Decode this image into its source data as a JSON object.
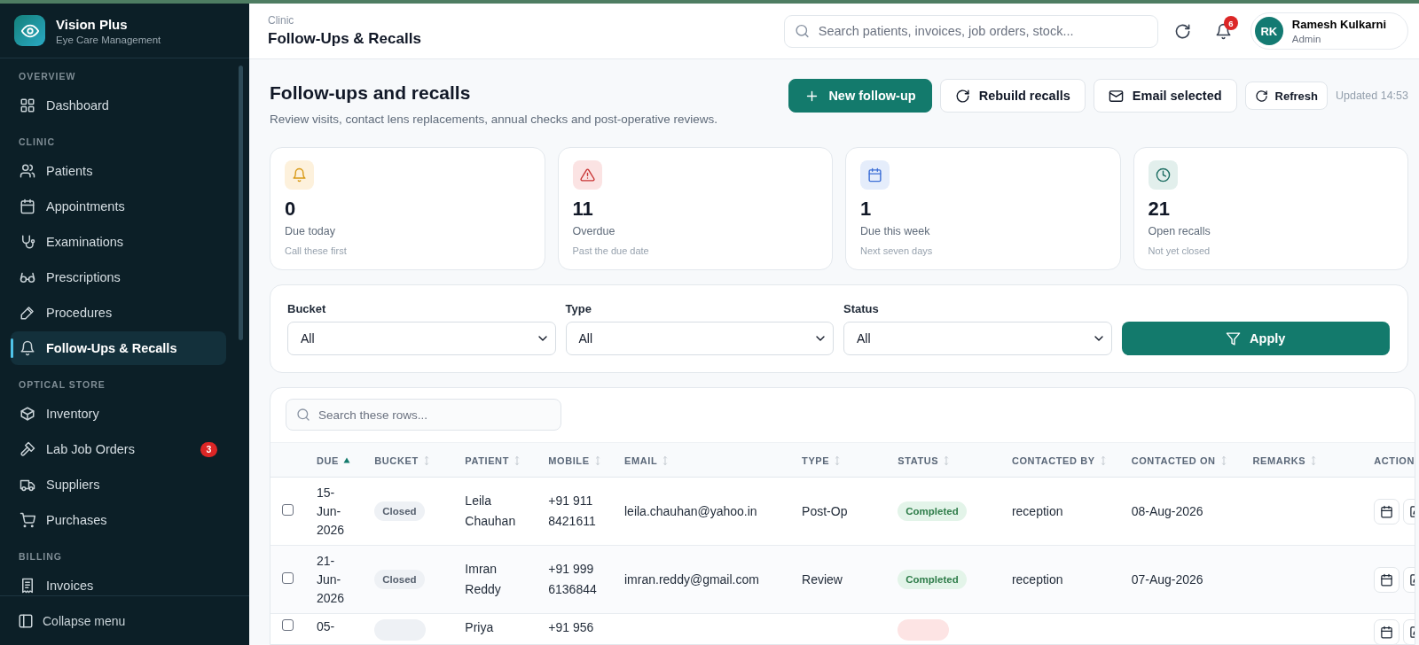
{
  "app": {
    "name": "Vision Plus",
    "subtitle": "Eye Care Management"
  },
  "sidebar": {
    "sections": [
      {
        "label": "OVERVIEW",
        "items": [
          {
            "label": "Dashboard",
            "selected": false
          }
        ]
      },
      {
        "label": "CLINIC",
        "items": [
          {
            "label": "Patients",
            "selected": false
          },
          {
            "label": "Appointments",
            "selected": false
          },
          {
            "label": "Examinations",
            "selected": false
          },
          {
            "label": "Prescriptions",
            "selected": false
          },
          {
            "label": "Procedures",
            "selected": false
          },
          {
            "label": "Follow-Ups & Recalls",
            "selected": true
          }
        ]
      },
      {
        "label": "OPTICAL STORE",
        "items": [
          {
            "label": "Inventory",
            "selected": false
          },
          {
            "label": "Lab Job Orders",
            "selected": false,
            "badge": "3"
          },
          {
            "label": "Suppliers",
            "selected": false
          },
          {
            "label": "Purchases",
            "selected": false
          }
        ]
      },
      {
        "label": "BILLING",
        "items": [
          {
            "label": "Invoices",
            "selected": false
          }
        ]
      }
    ],
    "collapse_label": "Collapse menu"
  },
  "header": {
    "breadcrumb": "Clinic",
    "title": "Follow-Ups & Recalls",
    "search": {
      "placeholder": "Search patients, invoices, job orders, stock..."
    },
    "notification_count": "6",
    "user": {
      "initials": "RK",
      "name": "Ramesh Kulkarni",
      "role": "Admin"
    }
  },
  "page": {
    "title": "Follow-ups and recalls",
    "subtitle": "Review visits, contact lens replacements, annual checks and post-operative reviews.",
    "actions": [
      {
        "label": "New follow-up",
        "kind": "primary"
      },
      {
        "label": "Rebuild recalls",
        "kind": "secondary"
      },
      {
        "label": "Email selected",
        "kind": "secondary"
      },
      {
        "label": "Refresh",
        "kind": "small"
      }
    ],
    "updated": "Updated 14:53"
  },
  "stats": [
    {
      "kind": "warning",
      "value": "0",
      "label": "Due today",
      "note": "Call these first"
    },
    {
      "kind": "danger",
      "value": "11",
      "label": "Overdue",
      "note": "Past the due date"
    },
    {
      "kind": "info",
      "value": "1",
      "label": "Due this week",
      "note": "Next seven days"
    },
    {
      "kind": "success",
      "value": "21",
      "label": "Open recalls",
      "note": "Not yet closed"
    }
  ],
  "filters": [
    {
      "label": "Bucket",
      "value": "All"
    },
    {
      "label": "Type",
      "value": "All"
    },
    {
      "label": "Status",
      "value": "All"
    }
  ],
  "apply_label": "Apply",
  "table": {
    "search": {
      "placeholder": "Search these rows..."
    },
    "columns": [
      {
        "label": "DUE",
        "sortable": true,
        "sorted": true
      },
      {
        "label": "BUCKET",
        "sortable": true,
        "sorted": false
      },
      {
        "label": "PATIENT",
        "sortable": true,
        "sorted": false
      },
      {
        "label": "MOBILE",
        "sortable": true,
        "sorted": false
      },
      {
        "label": "EMAIL",
        "sortable": true,
        "sorted": false
      },
      {
        "label": "TYPE",
        "sortable": true,
        "sorted": false
      },
      {
        "label": "STATUS",
        "sortable": true,
        "sorted": false
      },
      {
        "label": "CONTACTED BY",
        "sortable": true,
        "sorted": false
      },
      {
        "label": "CONTACTED ON",
        "sortable": true,
        "sorted": false
      },
      {
        "label": "REMARKS",
        "sortable": true,
        "sorted": false
      },
      {
        "label": "ACTION",
        "sortable": false,
        "sorted": false
      }
    ],
    "rows": [
      {
        "checked": false,
        "due": "15-Jun-2026",
        "bucket": {
          "label": "Closed",
          "kind": "neutral"
        },
        "patient": "Leila Chauhan",
        "mobile": "+91 911 8421611",
        "email": "leila.chauhan@yahoo.in",
        "type": "Post-Op",
        "status": {
          "label": "Completed",
          "kind": "success"
        },
        "contacted_by": "reception",
        "contacted_on": "08-Aug-2026"
      },
      {
        "checked": false,
        "due": "21-Jun-2026",
        "bucket": {
          "label": "Closed",
          "kind": "neutral"
        },
        "patient": "Imran Reddy",
        "mobile": "+91 999 6136844",
        "email": "imran.reddy@gmail.com",
        "type": "Review",
        "status": {
          "label": "Completed",
          "kind": "success"
        },
        "contacted_by": "reception",
        "contacted_on": "07-Aug-2026"
      },
      {
        "checked": false,
        "due": "05-",
        "bucket": {
          "kind": "neutral"
        },
        "patient": "Priya",
        "mobile": "+91 956",
        "status": {
          "kind": "danger"
        }
      }
    ]
  }
}
